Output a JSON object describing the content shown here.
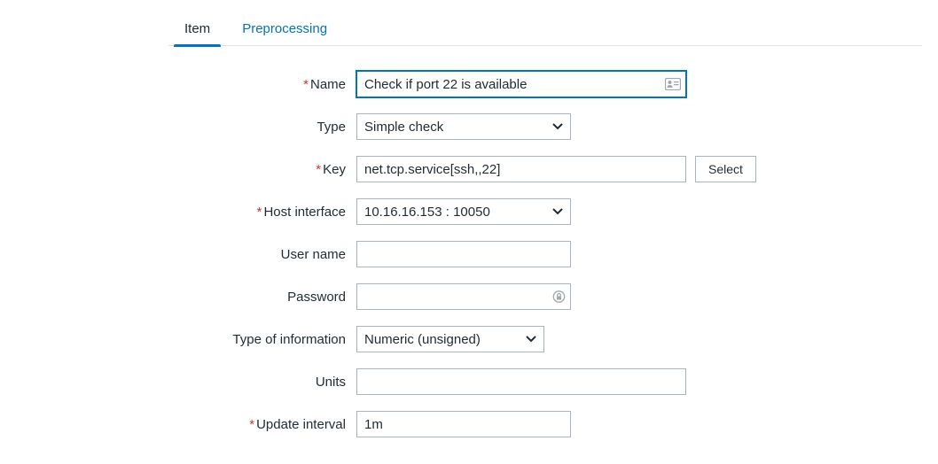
{
  "tabs": {
    "item": "Item",
    "preprocessing": "Preprocessing"
  },
  "labels": {
    "name": "Name",
    "type": "Type",
    "key": "Key",
    "host_interface": "Host interface",
    "user_name": "User name",
    "password": "Password",
    "type_of_info": "Type of information",
    "units": "Units",
    "update_interval": "Update interval"
  },
  "fields": {
    "name": "Check if port 22 is available",
    "type": "Simple check",
    "key": "net.tcp.service[ssh,,22]",
    "host_interface": "10.16.16.153 : 10050",
    "user_name": "",
    "password": "",
    "type_of_info": "Numeric (unsigned)",
    "units": "",
    "update_interval": "1m"
  },
  "buttons": {
    "select": "Select"
  }
}
